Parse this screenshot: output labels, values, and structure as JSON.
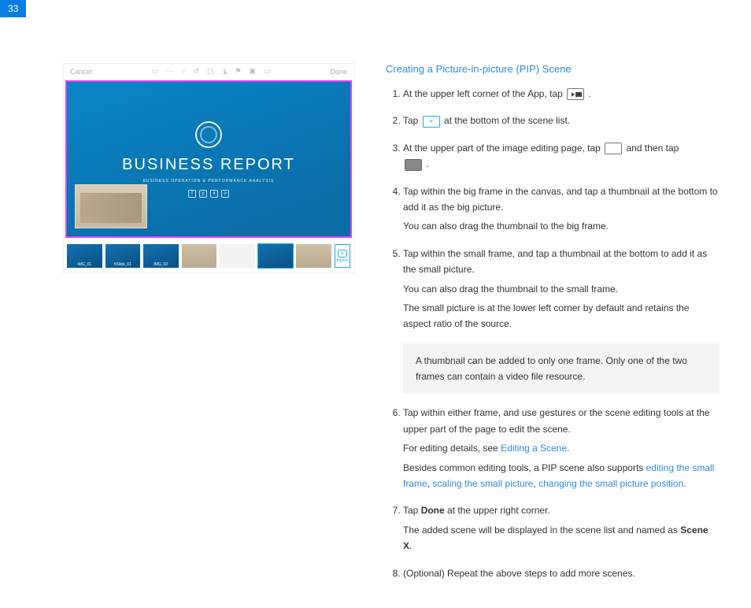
{
  "page_number": "33",
  "editor": {
    "cancel": "Cancel",
    "done": "Done",
    "canvas_title": "BUSINESS REPORT",
    "canvas_subtitle": "BUSINESS OPERATION & PERFORMANCE ANALYSIS",
    "thumbs": [
      "IMG_01",
      "#Slide_01",
      "IMG_02",
      "",
      "",
      "",
      ""
    ],
    "import": "Import"
  },
  "section_title": "Creating a Picture-in-picture (PIP) Scene",
  "steps": {
    "s1_a": "At the upper left corner of the App, tap ",
    "s1_b": " .",
    "s2_a": "Tap ",
    "s2_b": " at the bottom of the scene list.",
    "s3_a": "At the upper part of the image editing page, tap ",
    "s3_b": " and then tap ",
    "s3_c": " .",
    "s4_a": "Tap within the big frame in the canvas, and tap a thumbnail at the bottom to add it as the big picture.",
    "s4_b": "You can also drag the thumbnail to the big frame.",
    "s5_a": "Tap within the small frame, and tap a thumbnail at the bottom to add it as the small picture.",
    "s5_b": "You can also drag the thumbnail to the small frame.",
    "s5_c": "The small picture is at the lower left corner by default and retains the aspect ratio of the source.",
    "s6_a": "Tap within either frame, and use gestures or the scene editing tools at the upper part of the page to edit the scene.",
    "s6_b_pre": "For editing details, see ",
    "s6_b_link": "Editing a Scene",
    "s6_b_post": ".",
    "s6_c_pre": "Besides common editing tools, a PIP scene also supports ",
    "s6_c_l1": "editing the small frame",
    "s6_c_sep1": ", ",
    "s6_c_l2": "scaling the small picture",
    "s6_c_sep2": ", ",
    "s6_c_l3": "changing the small picture position",
    "s6_c_post": ".",
    "s7_a_pre": "Tap ",
    "s7_a_bold": "Done",
    "s7_a_post": " at the upper right corner.",
    "s7_b_pre": "The added scene will be displayed in the scene list and named as ",
    "s7_b_bold": "Scene X",
    "s7_b_post": ".",
    "s8": "(Optional) Repeat the above steps to add more scenes."
  },
  "note": "A thumbnail can be added to only one frame. Only one of the two frames can contain a video file resource.",
  "icons": {
    "plus": "+"
  }
}
